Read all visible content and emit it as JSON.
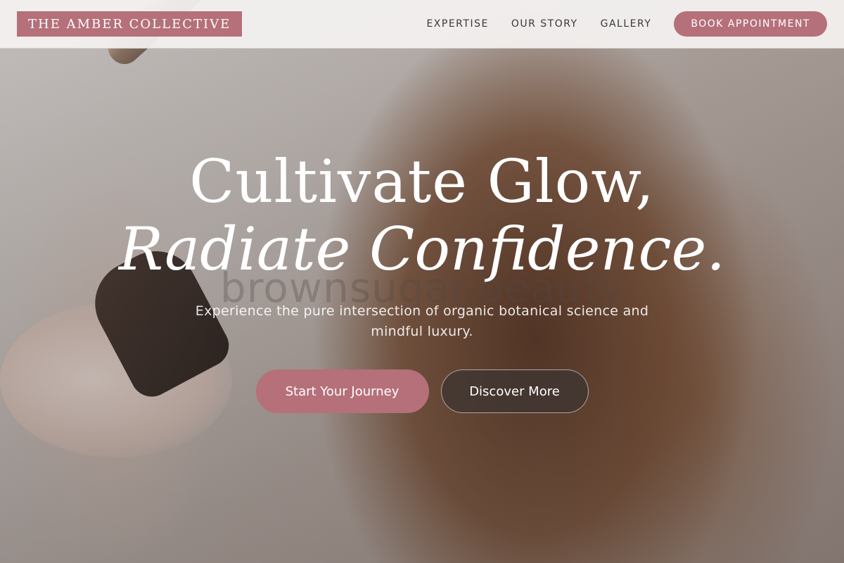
{
  "header": {
    "logo_text": "THE AMBER COLLECTIVE",
    "nav": [
      "EXPERTISE",
      "OUR STORY",
      "GALLERY"
    ],
    "cta_label": "BOOK APPOINTMENT"
  },
  "hero": {
    "headline_line1": "Cultivate Glow,",
    "headline_line2": "Radiate Confidence.",
    "watermark": "brownsugar.beauty",
    "subtitle": "Experience the pure intersection of organic botanical science and mindful luxury.",
    "primary_button": "Start Your Journey",
    "secondary_button": "Discover More"
  },
  "colors": {
    "accent": "#b5707a",
    "header_bg": "#f4f2f1",
    "nav_text": "#3d3634"
  }
}
